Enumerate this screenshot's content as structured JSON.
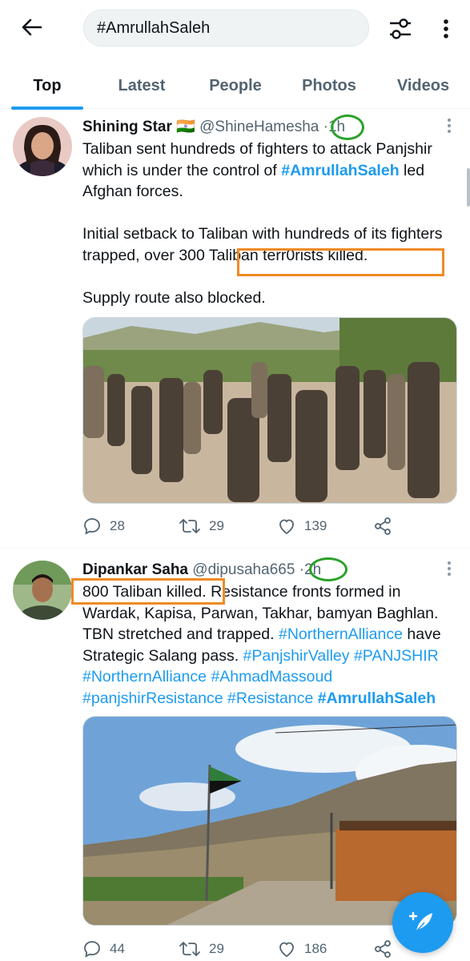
{
  "search": {
    "query": "#AmrullahSaleh"
  },
  "tabs": [
    {
      "label": "Top",
      "active": true
    },
    {
      "label": "Latest"
    },
    {
      "label": "People"
    },
    {
      "label": "Photos"
    },
    {
      "label": "Videos"
    }
  ],
  "tweets": [
    {
      "name": "Shining Star",
      "flag": "🇮🇳",
      "handle": "@ShineHamesha",
      "sep": "·",
      "time": "1h",
      "p1a": "Taliban sent hundreds of fighters to attack Panjshir which is under the control of ",
      "p1tag": "#AmrullahSaleh",
      "p1b": " led Afghan forces.",
      "p2a": "Initial setback to Taliban with hundreds of its fighters trapped, over ",
      "p2b": "300 Taliban terr0rists killed.",
      "p3": "Supply route also blocked.",
      "replies": "28",
      "retweets": "29",
      "likes": "139"
    },
    {
      "name": "Dipankar Saha",
      "handle": "@dipusaha665",
      "sep": "·",
      "time": "2h",
      "t1": "800 Taliban killed.",
      "t2": " Resistance fronts formed in Wardak, Kapisa, Parwan, Takhar, bamyan Baghlan. TBN stretched and trapped. ",
      "h1": "#NorthernAlliance",
      "t3": " have Strategic Salang pass. ",
      "h2": "#PanjshirValley",
      "h3": "#PANJSHIR",
      "h4": "#NorthernAlliance",
      "h5": "#AhmadMassoud",
      "h6": "#panjshirResistance",
      "h7": "#Resistance",
      "h8": "#AmrullahSaleh",
      "replies": "44",
      "retweets": "29",
      "likes": "186"
    }
  ],
  "colors": {
    "accent": "#1d9bf0",
    "highlight_time": "#2aa12a",
    "highlight_text": "#f08a24"
  }
}
